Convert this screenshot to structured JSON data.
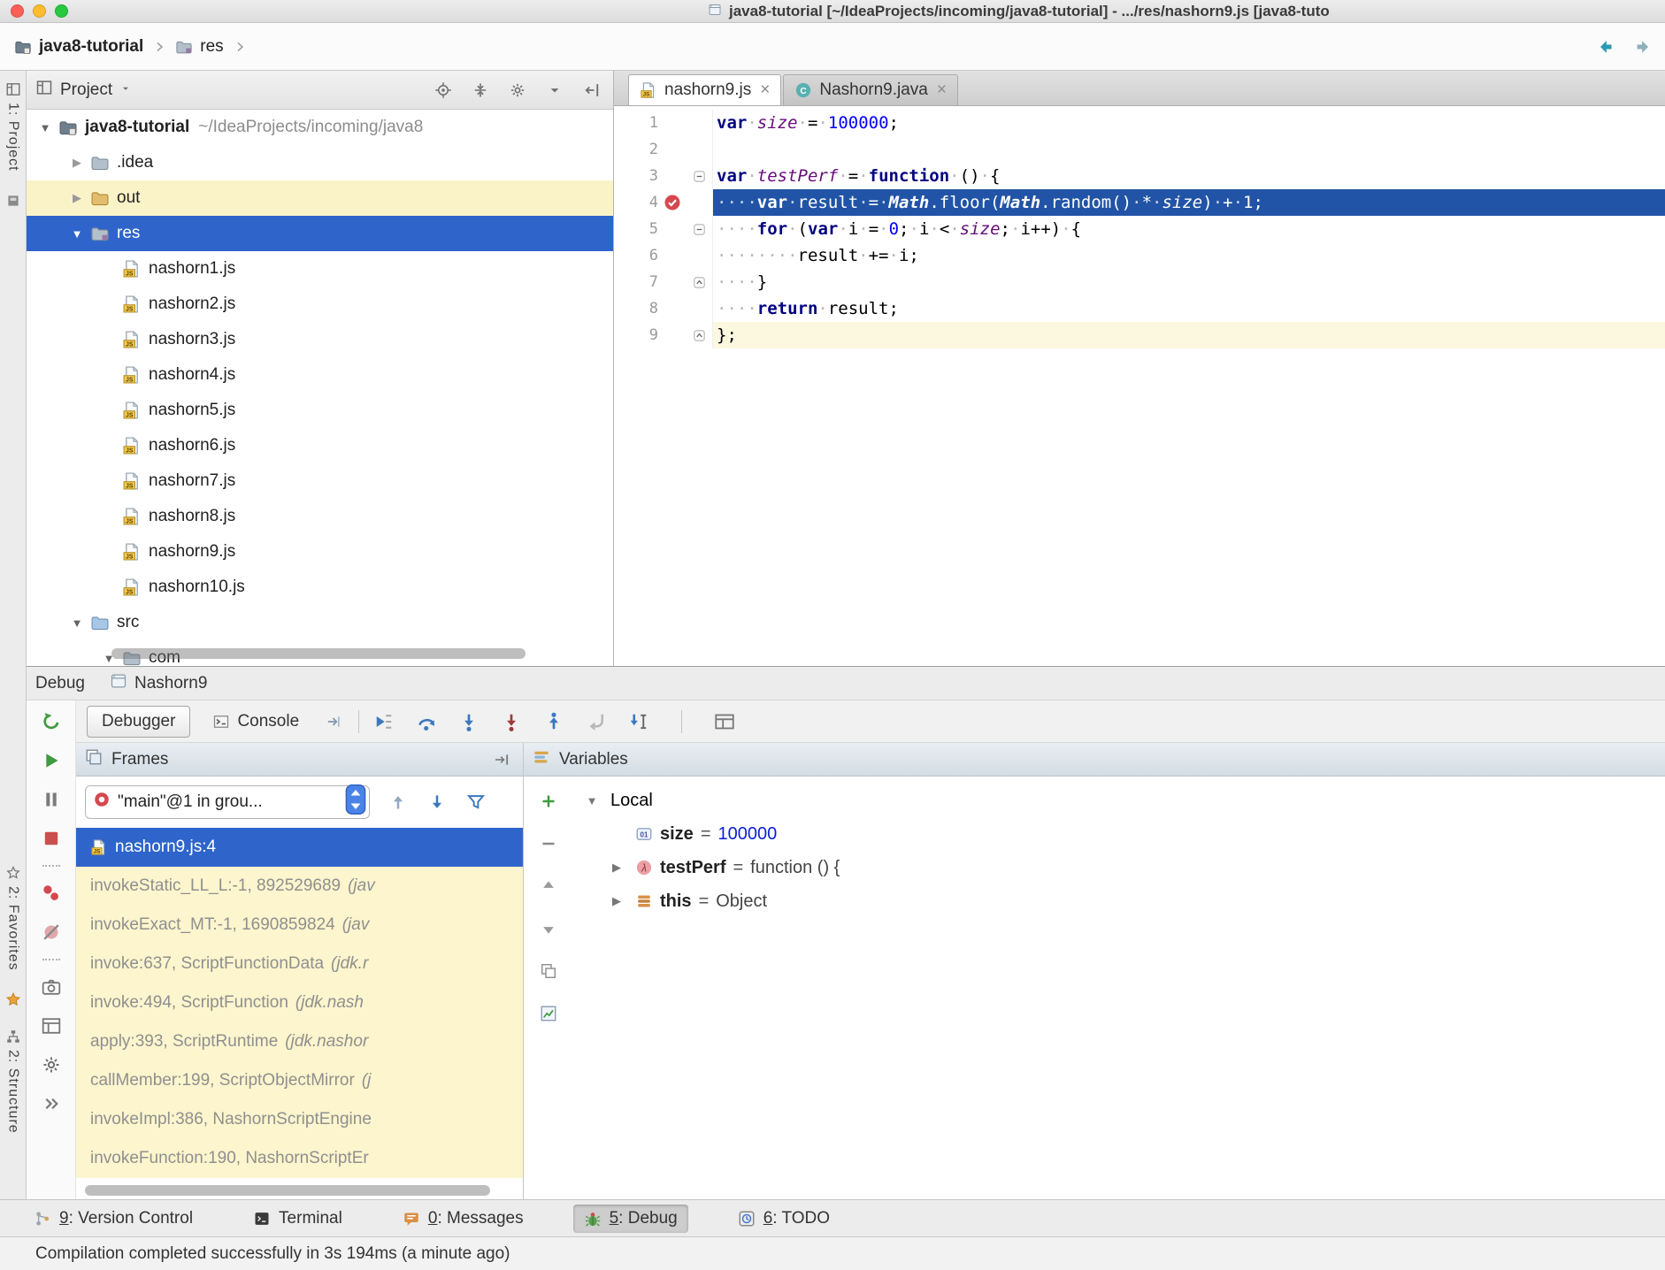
{
  "titlebar": {
    "traffic_lights": [
      "#ff5f57",
      "#febc2e",
      "#28c840"
    ],
    "title": "java8-tutorial [~/IdeaProjects/incoming/java8-tutorial] - .../res/nashorn9.js [java8-tuto"
  },
  "breadcrumbs": {
    "items": [
      {
        "label": "java8-tutorial",
        "icon": "project-folder",
        "bold": true
      },
      {
        "label": "res",
        "icon": "folder-res",
        "bold": false
      }
    ]
  },
  "navbar_actions": [
    "back-arrow",
    "forward-arrow"
  ],
  "left_stripe": {
    "top": [
      {
        "label": "1: Project",
        "icon": "project-tool"
      },
      {
        "icon": "tool-square"
      }
    ],
    "bottom": [
      {
        "label": "2: Favorites",
        "icon": "favorites-tool"
      },
      {
        "icon": "star-filled"
      },
      {
        "label": "2: Structure",
        "icon": "structure-tool"
      }
    ]
  },
  "project_panel": {
    "title": "Project",
    "header_actions": [
      "locate",
      "collapse-all",
      "gear",
      "caret-down-small",
      "hide-side"
    ],
    "tree": [
      {
        "label": "java8-tutorial",
        "suffix": "~/IdeaProjects/incoming/java8",
        "icon": "project-folder",
        "indent": 0,
        "expander": "open",
        "bold": true
      },
      {
        "label": ".idea",
        "icon": "folder",
        "indent": 1,
        "expander": "closed"
      },
      {
        "label": "out",
        "icon": "folder-out",
        "indent": 1,
        "expander": "closed",
        "row": "yellow"
      },
      {
        "label": "res",
        "icon": "folder-res",
        "indent": 1,
        "expander": "open",
        "selected": true
      },
      {
        "label": "nashorn1.js",
        "icon": "js-file",
        "indent": 2
      },
      {
        "label": "nashorn2.js",
        "icon": "js-file",
        "indent": 2
      },
      {
        "label": "nashorn3.js",
        "icon": "js-file",
        "indent": 2
      },
      {
        "label": "nashorn4.js",
        "icon": "js-file",
        "indent": 2
      },
      {
        "label": "nashorn5.js",
        "icon": "js-file",
        "indent": 2
      },
      {
        "label": "nashorn6.js",
        "icon": "js-file",
        "indent": 2
      },
      {
        "label": "nashorn7.js",
        "icon": "js-file",
        "indent": 2
      },
      {
        "label": "nashorn8.js",
        "icon": "js-file",
        "indent": 2
      },
      {
        "label": "nashorn9.js",
        "icon": "js-file",
        "indent": 2
      },
      {
        "label": "nashorn10.js",
        "icon": "js-file",
        "indent": 2
      },
      {
        "label": "src",
        "icon": "folder-src",
        "indent": 1,
        "expander": "open"
      },
      {
        "label": "com",
        "icon": "folder",
        "indent": 2,
        "expander": "open"
      }
    ]
  },
  "editor": {
    "tabs": [
      {
        "label": "nashorn9.js",
        "icon": "js-file",
        "active": true,
        "close": "×"
      },
      {
        "label": "Nashorn9.java",
        "icon": "class-file",
        "active": false,
        "close": "×"
      }
    ],
    "lines": [
      {
        "num": "1",
        "tokens": [
          [
            "var",
            "k"
          ],
          [
            "·",
            "w"
          ],
          [
            "size",
            "g"
          ],
          [
            "·",
            "w"
          ],
          [
            "=",
            "p"
          ],
          [
            "·",
            "w"
          ],
          [
            "100000",
            "n"
          ],
          [
            ";",
            "p"
          ]
        ]
      },
      {
        "num": "2",
        "tokens": []
      },
      {
        "num": "3",
        "fold": "minus",
        "tokens": [
          [
            "var",
            "k"
          ],
          [
            "·",
            "w"
          ],
          [
            "testPerf",
            "g"
          ],
          [
            "·",
            "w"
          ],
          [
            "=",
            "p"
          ],
          [
            "·",
            "w"
          ],
          [
            "function",
            "k"
          ],
          [
            "·",
            "w"
          ],
          [
            "()",
            "p"
          ],
          [
            "·",
            "w"
          ],
          [
            "{",
            "p"
          ]
        ]
      },
      {
        "num": "4",
        "exec": true,
        "breakpoint": true,
        "tokens": [
          [
            "····",
            "w"
          ],
          [
            "var",
            "k"
          ],
          [
            "·",
            "w"
          ],
          [
            "result",
            "p"
          ],
          [
            "·",
            "w"
          ],
          [
            "=",
            "p"
          ],
          [
            "·",
            "w"
          ],
          [
            "Math",
            "mi"
          ],
          [
            ".floor(",
            "p"
          ],
          [
            "Math",
            "mi"
          ],
          [
            ".random()",
            "p"
          ],
          [
            "·",
            "w"
          ],
          [
            "*",
            "p"
          ],
          [
            "·",
            "w"
          ],
          [
            "size",
            "g"
          ],
          [
            ")",
            "p"
          ],
          [
            "·",
            "w"
          ],
          [
            "+",
            "p"
          ],
          [
            "·",
            "w"
          ],
          [
            "1",
            "n"
          ],
          [
            ";",
            "p"
          ]
        ]
      },
      {
        "num": "5",
        "fold": "minus",
        "tokens": [
          [
            "····",
            "w"
          ],
          [
            "for",
            "k"
          ],
          [
            "·",
            "w"
          ],
          [
            "(",
            "p"
          ],
          [
            "var",
            "k"
          ],
          [
            "·",
            "w"
          ],
          [
            "i",
            "p"
          ],
          [
            "·",
            "w"
          ],
          [
            "=",
            "p"
          ],
          [
            "·",
            "w"
          ],
          [
            "0",
            "n"
          ],
          [
            ";",
            "p"
          ],
          [
            "·",
            "w"
          ],
          [
            "i",
            "p"
          ],
          [
            "·",
            "w"
          ],
          [
            "<",
            "p"
          ],
          [
            "·",
            "w"
          ],
          [
            "size",
            "g"
          ],
          [
            ";",
            "p"
          ],
          [
            "·",
            "w"
          ],
          [
            "i++)",
            "p"
          ],
          [
            "·",
            "w"
          ],
          [
            "{",
            "p"
          ]
        ]
      },
      {
        "num": "6",
        "tokens": [
          [
            "········",
            "w"
          ],
          [
            "result",
            "p"
          ],
          [
            "·",
            "w"
          ],
          [
            "+=",
            "p"
          ],
          [
            "·",
            "w"
          ],
          [
            "i",
            "p"
          ],
          [
            ";",
            "p"
          ]
        ]
      },
      {
        "num": "7",
        "fold": "end",
        "tokens": [
          [
            "····",
            "w"
          ],
          [
            "}",
            "p"
          ]
        ]
      },
      {
        "num": "8",
        "tokens": [
          [
            "····",
            "w"
          ],
          [
            "return",
            "k"
          ],
          [
            "·",
            "w"
          ],
          [
            "result",
            "p"
          ],
          [
            ";",
            "p"
          ]
        ]
      },
      {
        "num": "9",
        "fold": "end",
        "caret": true,
        "tokens": [
          [
            "};",
            "p"
          ]
        ]
      }
    ]
  },
  "debug": {
    "header": {
      "title": "Debug",
      "tab_label": "Nashorn9"
    },
    "view_tabs": [
      {
        "label": "Debugger",
        "active": true
      },
      {
        "label": "Console",
        "icon": "console",
        "active": false
      }
    ],
    "tabs_extra_icon": "output-arrow",
    "step_toolbar": [
      "show-execution-point",
      "step-over",
      "step-into",
      "force-step-into",
      "step-out",
      "drop-frame",
      "run-to-cursor",
      "sep",
      "layout-grid"
    ],
    "left_toolbar": [
      "rerun",
      "resume",
      "pause",
      "stop",
      "sep",
      "view-breakpoints",
      "mute-breakpoints",
      "sep",
      "thread-dump",
      "restore-layout",
      "gear",
      "more"
    ],
    "frames": {
      "title": "Frames",
      "pin_icon": "pin-right",
      "thread_combo": {
        "icon": "thread",
        "value": "\"main\"@1 in grou..."
      },
      "toolbar_icons": [
        "frame-up",
        "frame-down",
        "filter"
      ],
      "items": [
        {
          "label": "nashorn9.js:4",
          "icon": "js-file",
          "selected": true,
          "paren": ""
        },
        {
          "label": "invokeStatic_LL_L:-1, 892529689 ",
          "paren": "(jav",
          "grayed": true
        },
        {
          "label": "invokeExact_MT:-1, 1690859824 ",
          "paren": "(jav",
          "grayed": true
        },
        {
          "label": "invoke:637, ScriptFunctionData ",
          "paren": "(jdk.r",
          "grayed": true
        },
        {
          "label": "invoke:494, ScriptFunction ",
          "paren": "(jdk.nash",
          "grayed": true
        },
        {
          "label": "apply:393, ScriptRuntime ",
          "paren": "(jdk.nashor",
          "grayed": true
        },
        {
          "label": "callMember:199, ScriptObjectMirror ",
          "paren": "(j",
          "grayed": true
        },
        {
          "label": "invokeImpl:386, NashornScriptEngine",
          "paren": "",
          "grayed": true
        },
        {
          "label": "invokeFunction:190, NashornScriptEr",
          "paren": "",
          "grayed": true
        }
      ]
    },
    "watches_toolbar": [
      "add-watch",
      "remove-watch",
      "move-up",
      "move-down",
      "duplicate",
      "chart"
    ],
    "variables": {
      "title": "Variables",
      "items": [
        {
          "kind": "group",
          "label": "Local",
          "expander": "open",
          "indent": 0
        },
        {
          "kind": "var",
          "icon": "primitive",
          "name": "size",
          "value": "100000",
          "value_class": "num",
          "indent": 1
        },
        {
          "kind": "var",
          "icon": "lambda",
          "name": "testPerf",
          "value": "function () {",
          "value_class": "code",
          "expander": "closed",
          "indent": 1
        },
        {
          "kind": "var",
          "icon": "object",
          "name": "this",
          "value": "Object",
          "value_class": "code",
          "expander": "closed",
          "indent": 1
        }
      ]
    }
  },
  "toolbar_bottom": {
    "items": [
      {
        "mnemonic": "9",
        "label": ": Version Control",
        "icon": "vcs"
      },
      {
        "mnemonic": "",
        "label": "Terminal",
        "icon": "terminal"
      },
      {
        "mnemonic": "0",
        "label": ": Messages",
        "icon": "messages"
      },
      {
        "mnemonic": "5",
        "label": ": Debug",
        "icon": "debug-bug",
        "active": true
      },
      {
        "mnemonic": "6",
        "label": ": TODO",
        "icon": "todo"
      }
    ]
  },
  "statusbar": {
    "message": "Compilation completed successfully in 3s 194ms (a minute ago)"
  },
  "colors": {
    "selection": "#2f65ca",
    "execution_line": "#2154a6",
    "breakpoint": "#d6484f",
    "keyword": "#000080",
    "number": "#0000ff",
    "global_variable": "#660e7a",
    "modified_row": "#fbf3c8"
  }
}
